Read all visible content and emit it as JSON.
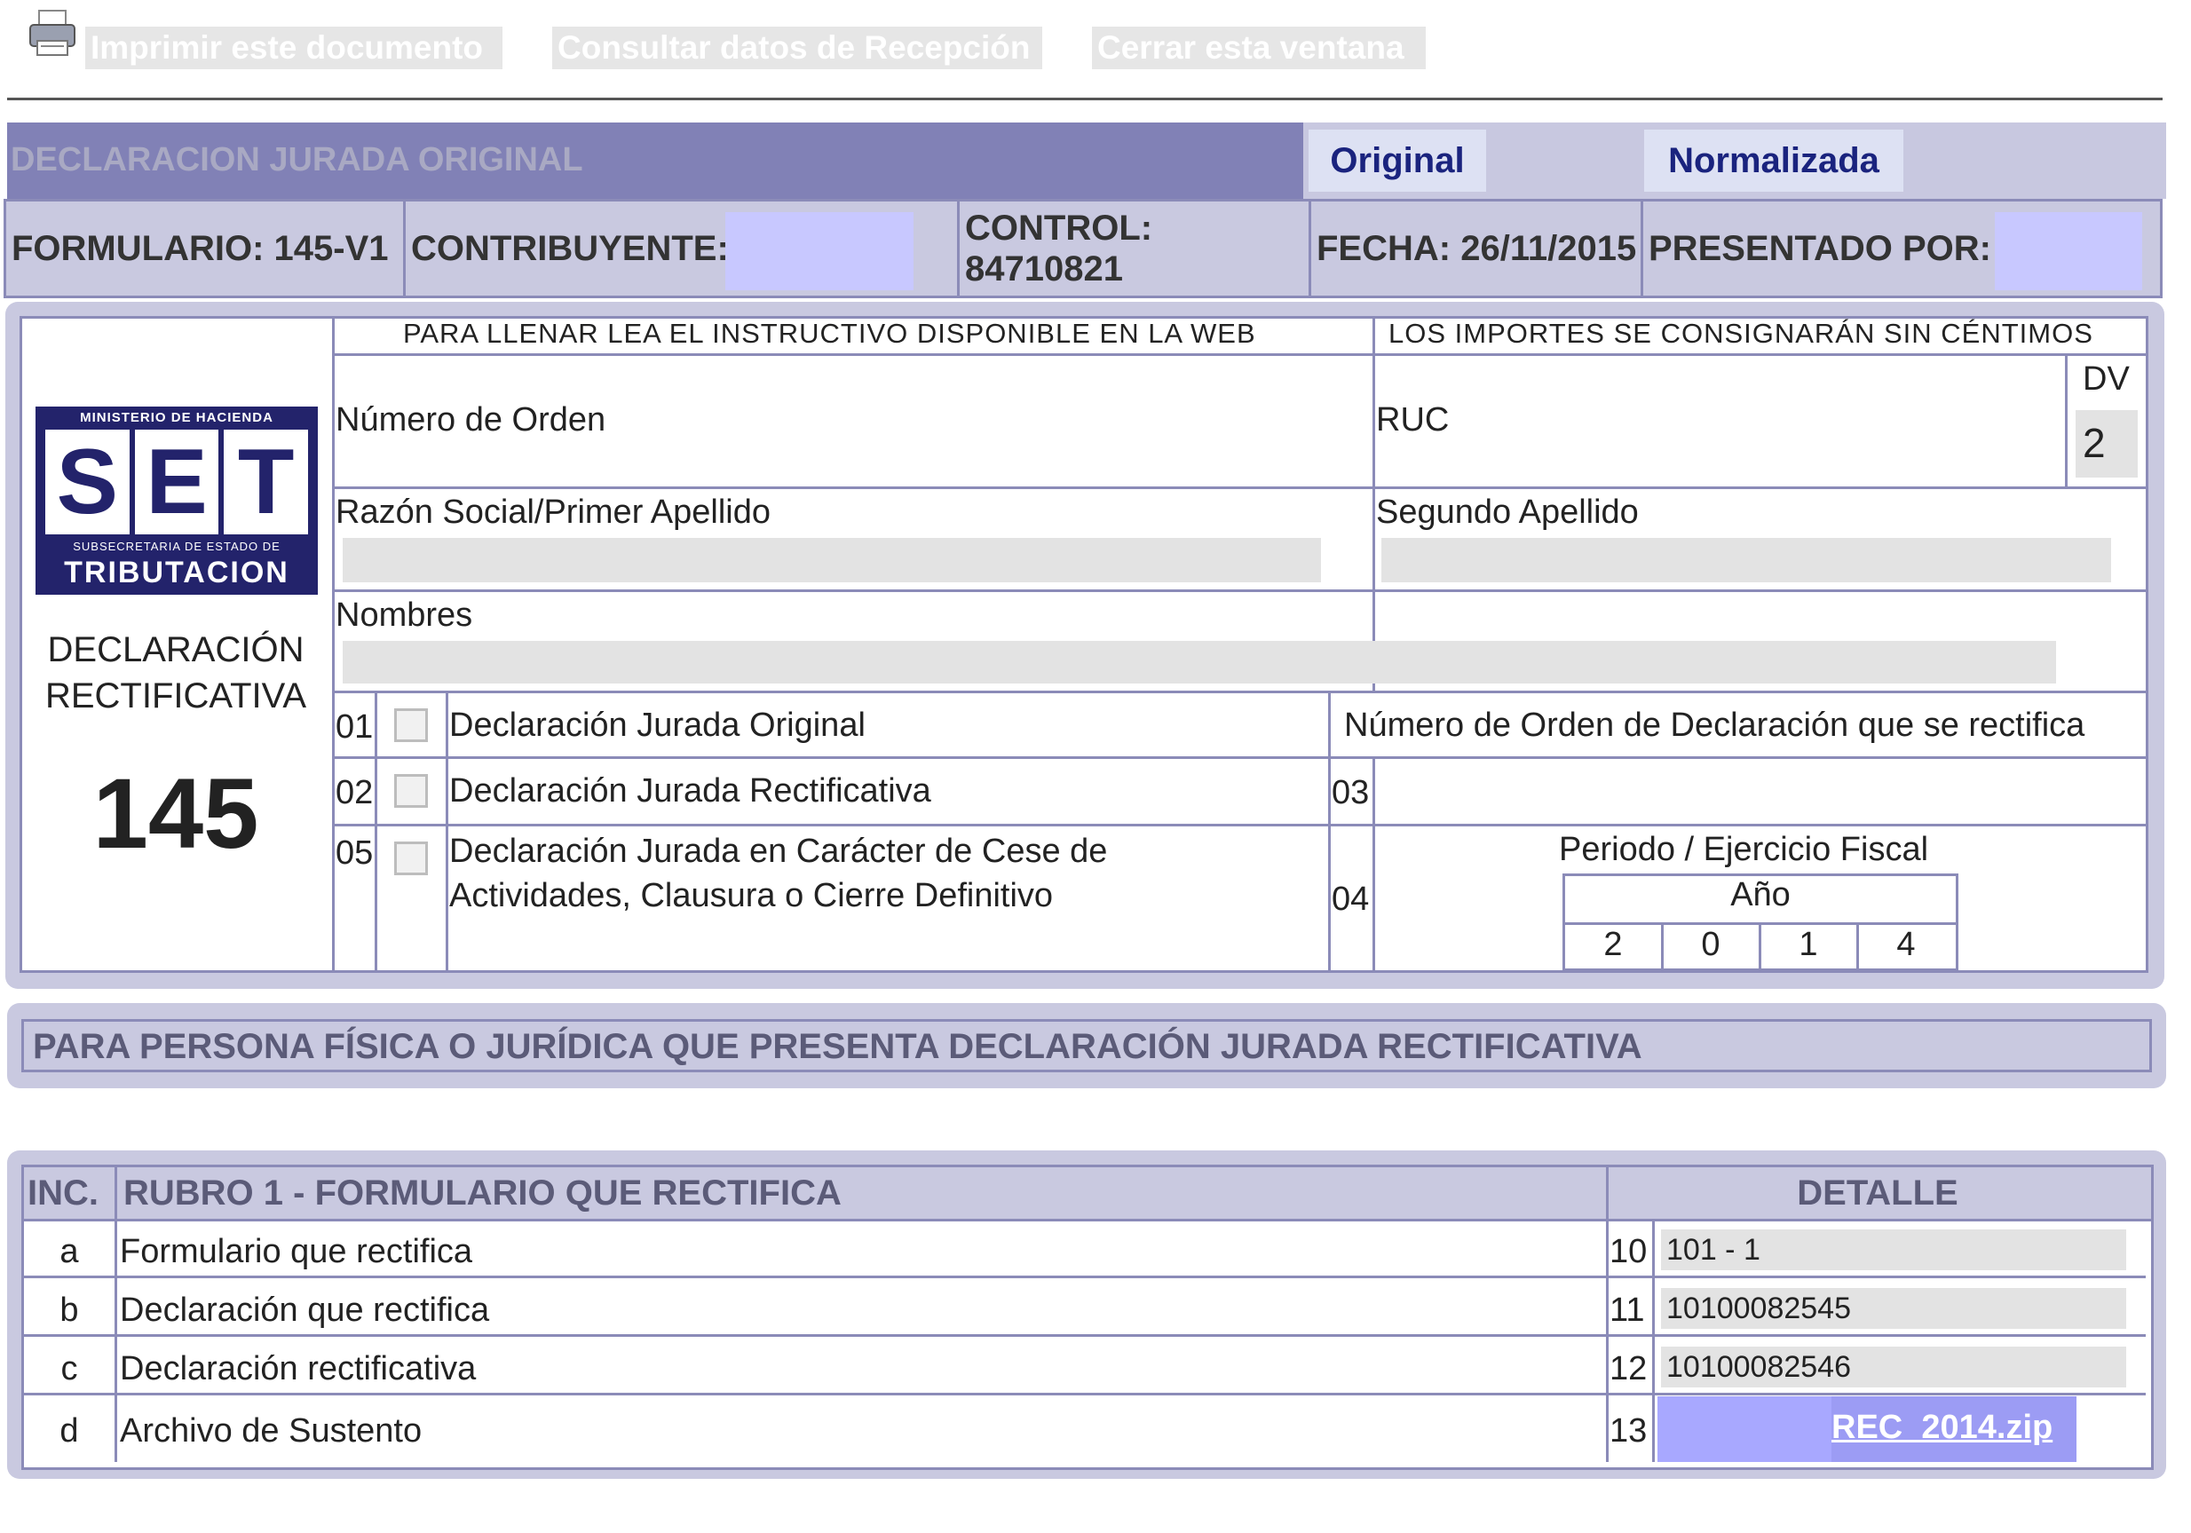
{
  "toolbar": {
    "print_label": "Imprimir este documento",
    "consult_label": "Consultar datos de Recepción",
    "close_label": "Cerrar esta ventana"
  },
  "header": {
    "title": "DECLARACION JURADA ORIGINAL",
    "tab_original": "Original",
    "tab_normalizada": "Normalizada",
    "formulario": "FORMULARIO: 145-V1",
    "contribuyente_label": "CONTRIBUYENTE:",
    "control_label": "CONTROL:",
    "control_value": "84710821",
    "fecha": "FECHA: 26/11/2015",
    "presentado_label": "PRESENTADO POR:"
  },
  "form": {
    "instr_left": "PARA LLENAR LEA EL INSTRUCTIVO DISPONIBLE EN LA WEB",
    "instr_right": "LOS IMPORTES SE CONSIGNARÁN SIN CÉNTIMOS",
    "numero_orden_label": "Número de Orden",
    "ruc_label": "RUC",
    "dv_label": "DV",
    "dv_value": "2",
    "razon_label": "Razón Social/Primer Apellido",
    "segundo_label": "Segundo Apellido",
    "nombres_label": "Nombres",
    "logo": {
      "top": "MINISTERIO DE HACIENDA",
      "l1": "S",
      "l2": "E",
      "l3": "T",
      "sub": "SUBSECRETARIA DE ESTADO DE",
      "bottom": "TRIBUTACION"
    },
    "form_type_line1": "DECLARACIÓN",
    "form_type_line2": "RECTIFICATIVA",
    "form_number": "145",
    "options": [
      {
        "code": "01",
        "label": "Declaración Jurada Original"
      },
      {
        "code": "02",
        "label": "Declaración Jurada Rectificativa"
      },
      {
        "code": "05",
        "label_1": "Declaración Jurada en Carácter de Cese de",
        "label_2": "Actividades, Clausura o Cierre Definitivo"
      }
    ],
    "rectifica_label": "Número de Orden de Declaración que se rectifica",
    "code_03": "03",
    "code_04": "04",
    "periodo_label": "Periodo / Ejercicio Fiscal",
    "anio_label": "Año",
    "anio_digits": [
      "2",
      "0",
      "1",
      "4"
    ]
  },
  "section_banner": "PARA PERSONA FÍSICA O JURÍDICA QUE PRESENTA DECLARACIÓN JURADA RECTIFICATIVA",
  "rubro": {
    "col_inc": "INC.",
    "col_title": "RUBRO 1 - FORMULARIO QUE RECTIFICA",
    "col_detalle": "DETALLE",
    "rows": [
      {
        "inc": "a",
        "label": "Formulario que rectifica",
        "num": "10",
        "value": "101 - 1"
      },
      {
        "inc": "b",
        "label": "Declaración que rectifica",
        "num": "11",
        "value": "10100082545"
      },
      {
        "inc": "c",
        "label": "Declaración rectificativa",
        "num": "12",
        "value": "10100082546"
      },
      {
        "inc": "d",
        "label": "Archivo de Sustento",
        "num": "13",
        "link": "REC_2014.zip"
      }
    ]
  }
}
